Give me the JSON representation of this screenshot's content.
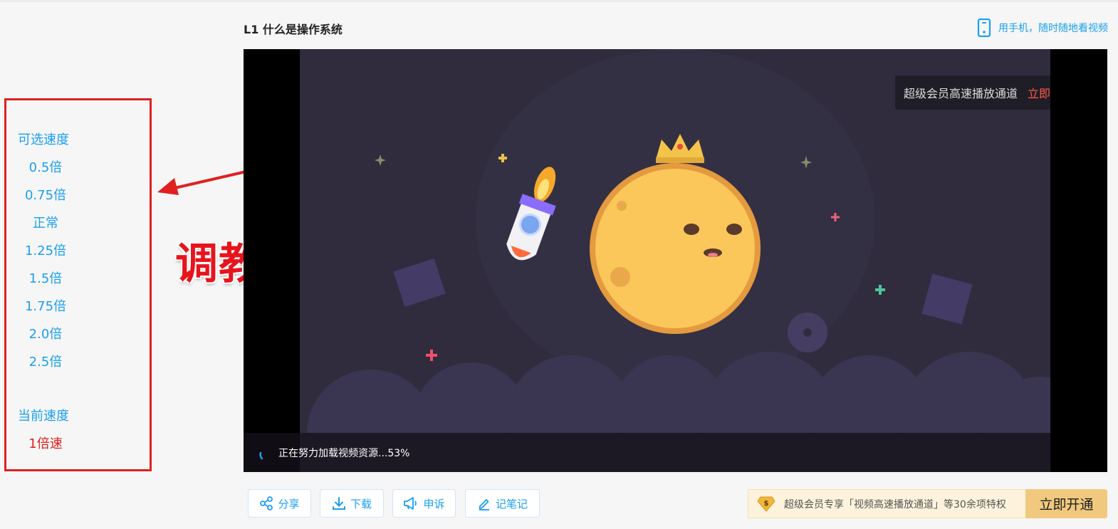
{
  "header": {
    "lesson_title": "L1 什么是操作系统",
    "mobile_link": "用手机，随时随地看视频"
  },
  "speed_panel": {
    "heading": "可选速度",
    "options": [
      "0.5倍",
      "0.75倍",
      "正常",
      "1.25倍",
      "1.5倍",
      "1.75倍",
      "2.0倍",
      "2.5倍"
    ],
    "current_heading": "当前速度",
    "current_value": "1倍速"
  },
  "annotation": {
    "text": "调教后",
    "color": "#e8141c"
  },
  "player": {
    "vip_tip_text": "超级会员高速播放通道",
    "vip_tip_action": "立即开通",
    "loading_text": "正在努力加载视频资源...53%",
    "loading_progress": 0.53
  },
  "actions": {
    "share": "分享",
    "download": "下载",
    "appeal": "申诉",
    "notes": "记笔记"
  },
  "vip_banner": {
    "text": "超级会员专享「视频高速播放通道」等30余项特权",
    "button": "立即开通"
  },
  "colors": {
    "accent": "#1a9ff0",
    "alert": "#e02020",
    "gold": "#f0c97e"
  }
}
